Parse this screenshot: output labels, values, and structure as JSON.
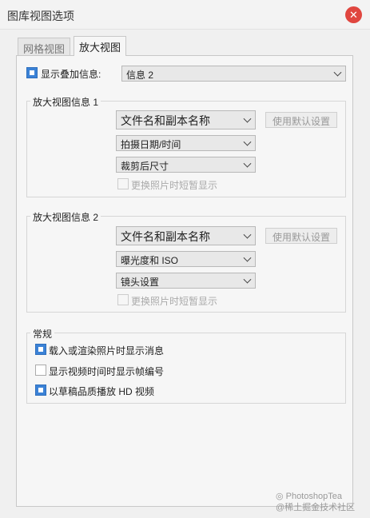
{
  "window": {
    "title": "图库视图选项",
    "close_symbol": "✕"
  },
  "tabs": [
    {
      "label": "网格视图",
      "active": false
    },
    {
      "label": "放大视图",
      "active": true
    }
  ],
  "overlay": {
    "label": "显示叠加信息:",
    "checked": true,
    "value": "信息 2"
  },
  "info1": {
    "title": "放大视图信息 1",
    "field1": "文件名和副本名称",
    "field2": "拍摄日期/时间",
    "field3": "裁剪后尺寸",
    "use_default": "使用默认设置",
    "brief_label": "更换照片时短暂显示",
    "brief_checked": false
  },
  "info2": {
    "title": "放大视图信息 2",
    "field1": "文件名和副本名称",
    "field2": "曝光度和 ISO",
    "field3": "镜头设置",
    "use_default": "使用默认设置",
    "brief_label": "更换照片时短暂显示",
    "brief_checked": false
  },
  "general": {
    "title": "常规",
    "options": [
      {
        "label": "载入或渲染照片时显示消息",
        "checked": true
      },
      {
        "label": "显示视频时间时显示帧编号",
        "checked": false
      },
      {
        "label": "以草稿品质播放 HD 视频",
        "checked": true
      }
    ]
  },
  "watermark": {
    "line1": "PhotoshopTea",
    "line2": "@稀土掘金技术社区"
  },
  "colors": {
    "accent": "#3b82d6",
    "close": "#e0463f"
  }
}
